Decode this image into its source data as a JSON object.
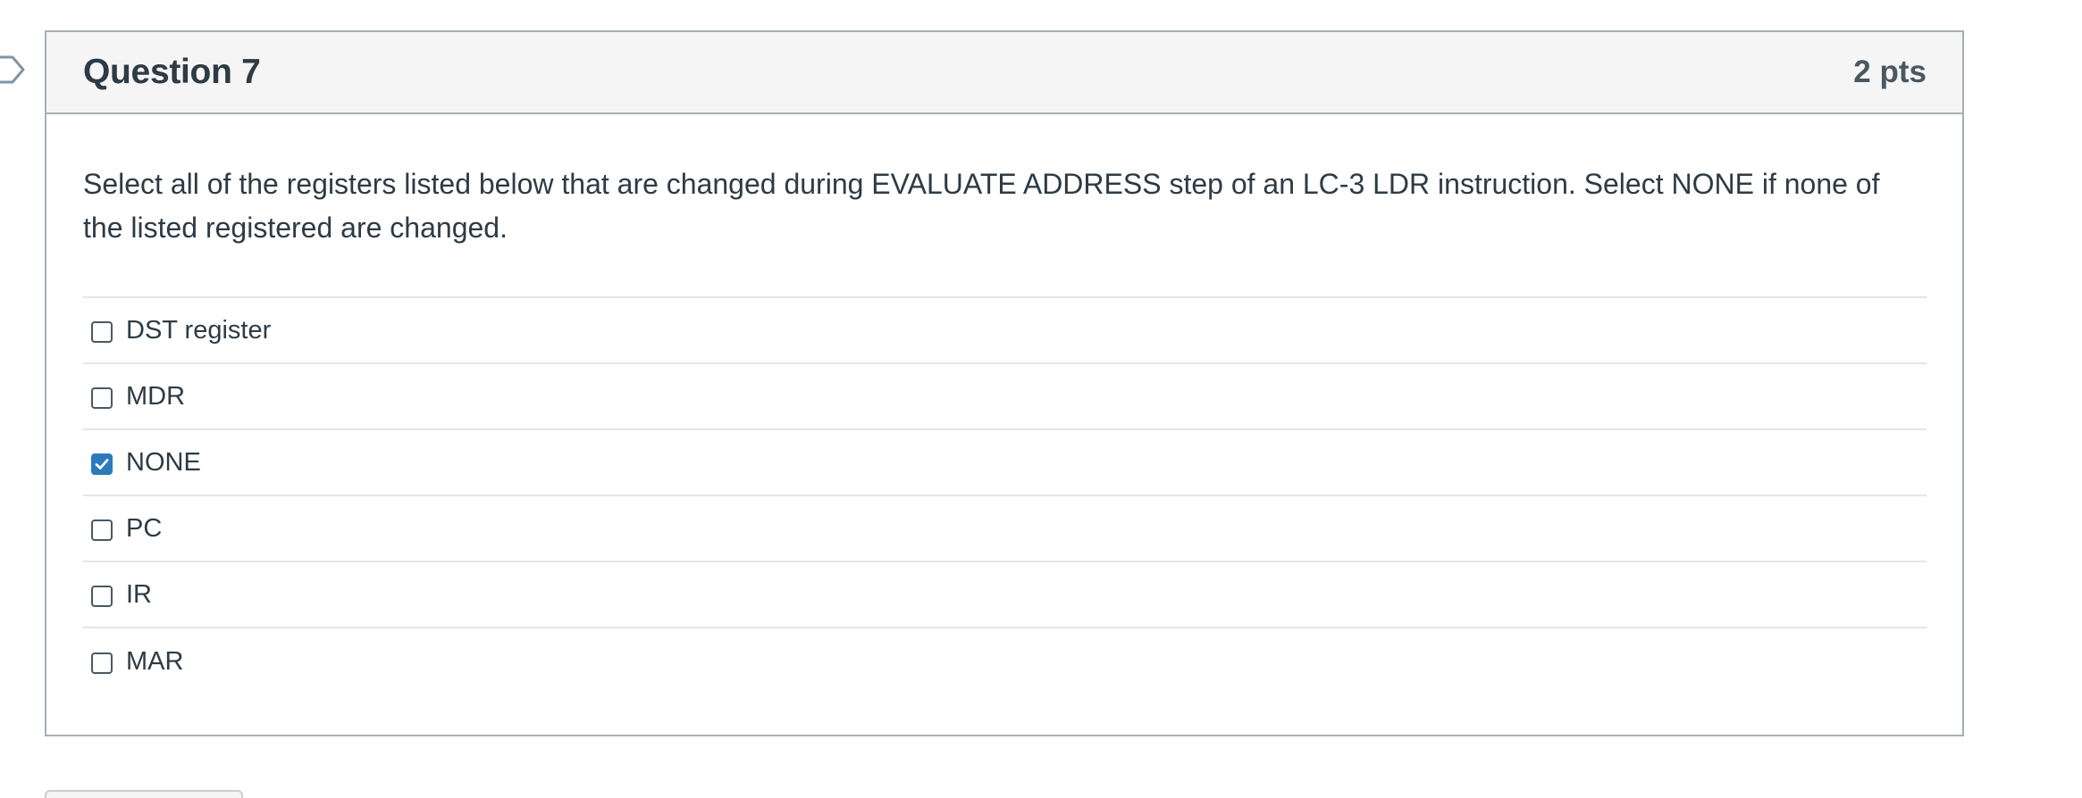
{
  "question": {
    "title": "Question 7",
    "points": "2 pts",
    "text": "Select all of the registers listed below that are changed during EVALUATE ADDRESS step of an LC-3 LDR instruction. Select NONE if none of the listed registered are changed.",
    "answers": [
      {
        "label": "DST register",
        "checked": false
      },
      {
        "label": "MDR",
        "checked": false
      },
      {
        "label": "NONE",
        "checked": true
      },
      {
        "label": "PC",
        "checked": false
      },
      {
        "label": "IR",
        "checked": false
      },
      {
        "label": "MAR",
        "checked": false
      }
    ]
  },
  "colors": {
    "accent": "#2b7abc",
    "border": "#a5afb5",
    "header_bg": "#f5f5f5",
    "text": "#2d3b45"
  },
  "icons": {
    "flag": "question-flag-icon",
    "check": "checkmark-icon"
  }
}
